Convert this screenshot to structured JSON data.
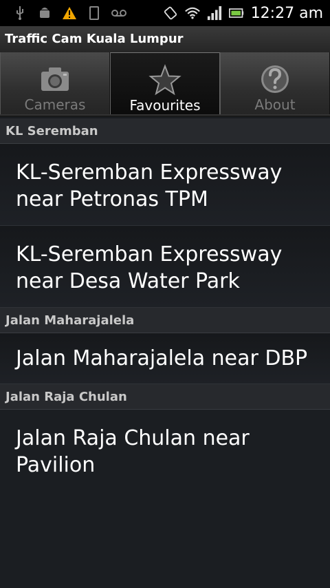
{
  "status_bar": {
    "time": "12:27 am",
    "left_icons": [
      "usb-icon",
      "android-debug-icon",
      "warning-icon",
      "sd-card-icon",
      "voicemail-icon"
    ],
    "right_icons": [
      "rotate-icon",
      "wifi-icon",
      "signal-icon",
      "battery-icon"
    ]
  },
  "app": {
    "title": "Traffic Cam Kuala Lumpur"
  },
  "tabs": [
    {
      "label": "Cameras",
      "icon": "camera-icon",
      "active": false
    },
    {
      "label": "Favourites",
      "icon": "star-icon",
      "active": true
    },
    {
      "label": "About",
      "icon": "help-icon",
      "active": false
    }
  ],
  "sections": [
    {
      "header": "KL Seremban",
      "items": [
        {
          "label": "KL-Seremban Expressway near Petronas TPM"
        },
        {
          "label": "KL-Seremban Expressway near Desa Water Park"
        }
      ]
    },
    {
      "header": "Jalan Maharajalela",
      "items": [
        {
          "label": "Jalan Maharajalela near DBP"
        }
      ]
    },
    {
      "header": "Jalan Raja Chulan",
      "items": [
        {
          "label": "Jalan Raja Chulan near Pavilion"
        }
      ]
    }
  ],
  "colors": {
    "accent_warning": "#f0a500",
    "battery_green": "#7ac943"
  }
}
